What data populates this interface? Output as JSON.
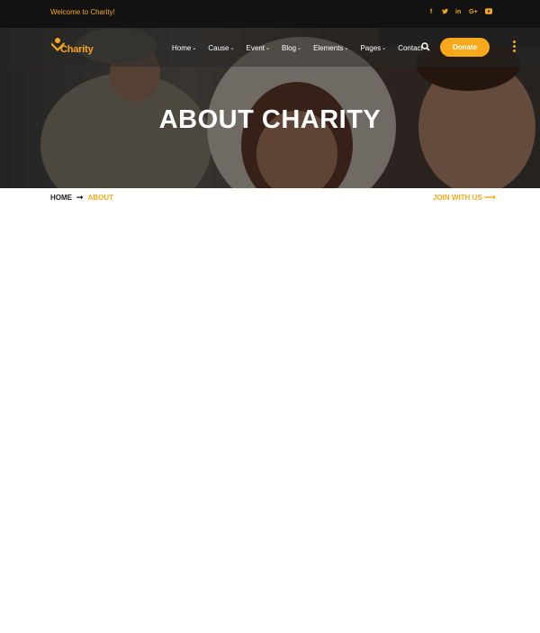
{
  "topbar": {
    "welcome": "Welcome to Charity!",
    "social_icons": [
      "facebook-icon",
      "twitter-icon",
      "linkedin-icon",
      "google-plus-icon",
      "youtube-icon"
    ]
  },
  "header": {
    "logo_text": "Charity",
    "nav": [
      {
        "label": "Home",
        "has_dropdown": true
      },
      {
        "label": "Cause",
        "has_dropdown": true
      },
      {
        "label": "Event",
        "has_dropdown": true
      },
      {
        "label": "Blog",
        "has_dropdown": true
      },
      {
        "label": "Elements",
        "has_dropdown": true
      },
      {
        "label": "Pages",
        "has_dropdown": true
      },
      {
        "label": "Contact",
        "has_dropdown": false
      }
    ],
    "donate_label": "Donate"
  },
  "hero": {
    "title": "ABOUT CHARITY"
  },
  "breadcrumb": {
    "home": "HOME",
    "current": "ABOUT",
    "join_label": "JOIN WITH US"
  },
  "colors": {
    "accent": "#f7a81b",
    "topbar_bg": "#121212",
    "text_dark": "#222222"
  }
}
